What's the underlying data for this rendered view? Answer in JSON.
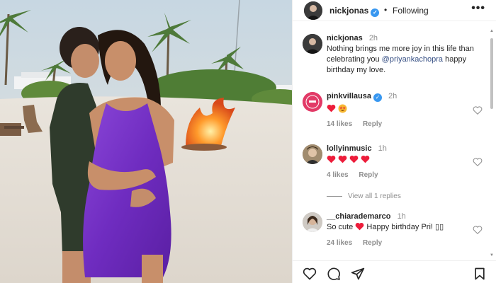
{
  "post": {
    "username": "nickjonas",
    "separator": "•",
    "follow_status": "Following",
    "more": "•••",
    "caption": {
      "username": "nickjonas",
      "time": "2h",
      "text_before": "Nothing brings me more joy in this life than celebrating you ",
      "mention": "@priyankachopra",
      "text_after": " happy birthday my love."
    }
  },
  "comments": [
    {
      "username": "pinkvillausa",
      "verified": true,
      "time": "2h",
      "emoji": "heart-and-star-struck",
      "likes": "14 likes",
      "reply": "Reply"
    },
    {
      "username": "lollyinmusic",
      "verified": false,
      "time": "1h",
      "emoji": "four-red-hearts",
      "likes": "4 likes",
      "reply": "Reply",
      "view_replies": "View all 1 replies"
    },
    {
      "username": "__chiarademarco",
      "verified": false,
      "time": "1h",
      "text_before": "So cute ",
      "text_after": " Happy birthday Pri! ▯▯",
      "likes": "24 likes",
      "reply": "Reply"
    }
  ],
  "icons": {
    "like": "heart-outline-icon",
    "comment": "comment-bubble-icon",
    "share": "paper-plane-icon",
    "save": "bookmark-icon",
    "verified": "verified-badge-icon"
  },
  "colors": {
    "verified": "#3897f0",
    "heart": "#ed1d3b",
    "mention": "#385185",
    "muted": "#8e8e8e",
    "dress": "#7b34c8"
  }
}
